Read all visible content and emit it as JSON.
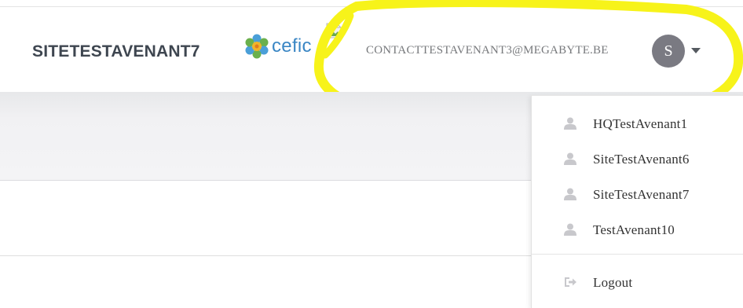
{
  "header": {
    "site_name": "SITETESTAVENANT7",
    "logo_text": "cefic",
    "email": "CONTACTTESTAVENANT3@MEGABYTE.BE",
    "avatar_initial": "S"
  },
  "dropdown": {
    "items": [
      {
        "label": "HQTestAvenant1",
        "icon": "user-icon"
      },
      {
        "label": "SiteTestAvenant6",
        "icon": "user-icon"
      },
      {
        "label": "SiteTestAvenant7",
        "icon": "user-icon"
      },
      {
        "label": "TestAvenant10",
        "icon": "user-icon"
      }
    ],
    "logout": {
      "label": "Logout",
      "icon": "sign-out-icon"
    }
  },
  "colors": {
    "highlight": "#f7f31a",
    "logo_blue": "#3a86c4",
    "avatar_bg": "#7a7a82",
    "icon_gray": "#c8c8cc"
  }
}
